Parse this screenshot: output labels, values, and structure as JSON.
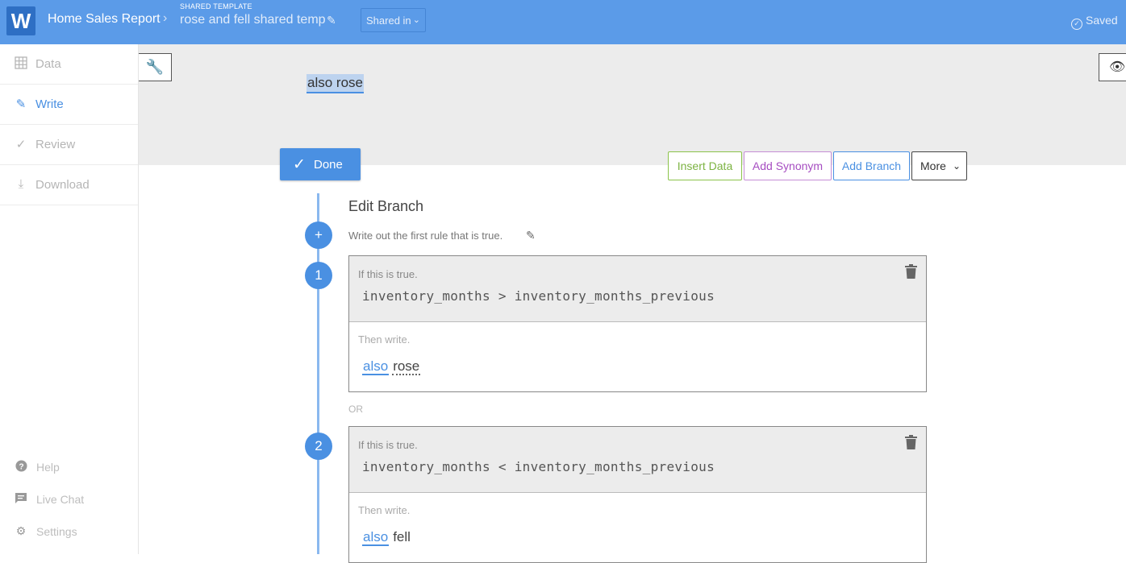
{
  "header": {
    "logo": "W",
    "report_name": "Home Sales Report",
    "separator": "›",
    "template_label": "SHARED TEMPLATE",
    "template_name": "rose and fell shared temp",
    "shared_button": "Shared in",
    "saved_label": "Saved",
    "background_color": "#5b9be8"
  },
  "sidebar": {
    "items": [
      {
        "label": "Data",
        "icon": "grid-icon"
      },
      {
        "label": "Write",
        "icon": "pencil-icon"
      },
      {
        "label": "Review",
        "icon": "checkmark-icon"
      },
      {
        "label": "Download",
        "icon": "download-icon"
      }
    ],
    "active": "Write",
    "bottom": [
      {
        "label": "Help",
        "icon": "help-icon"
      },
      {
        "label": "Live Chat",
        "icon": "chat-icon"
      },
      {
        "label": "Settings",
        "icon": "gear-icon"
      }
    ]
  },
  "preview": {
    "text": "also rose"
  },
  "actions": {
    "done": "Done",
    "insert_data": "Insert Data",
    "add_synonym": "Add Synonym",
    "add_branch": "Add Branch",
    "more": "More"
  },
  "branch": {
    "title": "Edit Branch",
    "description": "Write out the first rule that is true.",
    "add_symbol": "+",
    "or_label": "OR",
    "rules": [
      {
        "number": "1",
        "if_hint": "If this is true.",
        "condition": "inventory_months > inventory_months_previous",
        "then_hint": "Then write.",
        "word1": "also",
        "word2": "rose"
      },
      {
        "number": "2",
        "if_hint": "If this is true.",
        "condition": "inventory_months < inventory_months_previous",
        "then_hint": "Then write.",
        "word1": "also",
        "word2": "fell"
      }
    ]
  },
  "colors": {
    "accent": "#4a90e2",
    "insert_data": "#7cb342",
    "add_synonym": "#a64dc1"
  }
}
